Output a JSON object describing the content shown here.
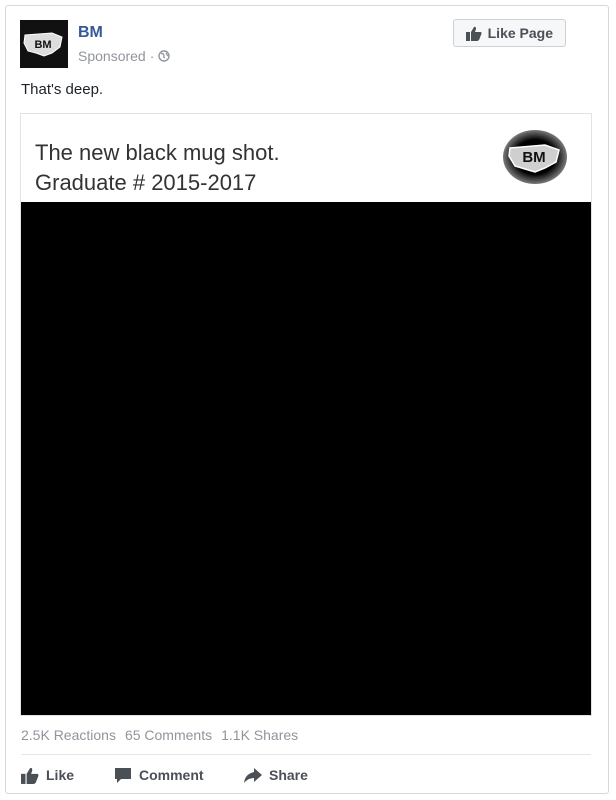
{
  "post": {
    "page_name": "BM",
    "sponsored": "Sponsored",
    "separator": "·",
    "like_page_label": "Like Page",
    "text": "That's deep.",
    "avatar_logo_text": "BM"
  },
  "card": {
    "line1": "The new black mug shot.",
    "line2": "Graduate # 2015-2017",
    "logo_text": "BM"
  },
  "stats": {
    "reactions": "2.5K Reactions",
    "comments": "65 Comments",
    "shares": "1.1K Shares"
  },
  "actions": {
    "like": "Like",
    "comment": "Comment",
    "share": "Share"
  },
  "icons": {
    "like": "thumbs-up-icon",
    "comment": "speech-bubble-icon",
    "share": "share-arrow-icon",
    "audience": "globe-icon"
  },
  "colors": {
    "page_name": "#365899",
    "meta": "#90949c",
    "button_text": "#4b4f56",
    "image": "#000000"
  }
}
